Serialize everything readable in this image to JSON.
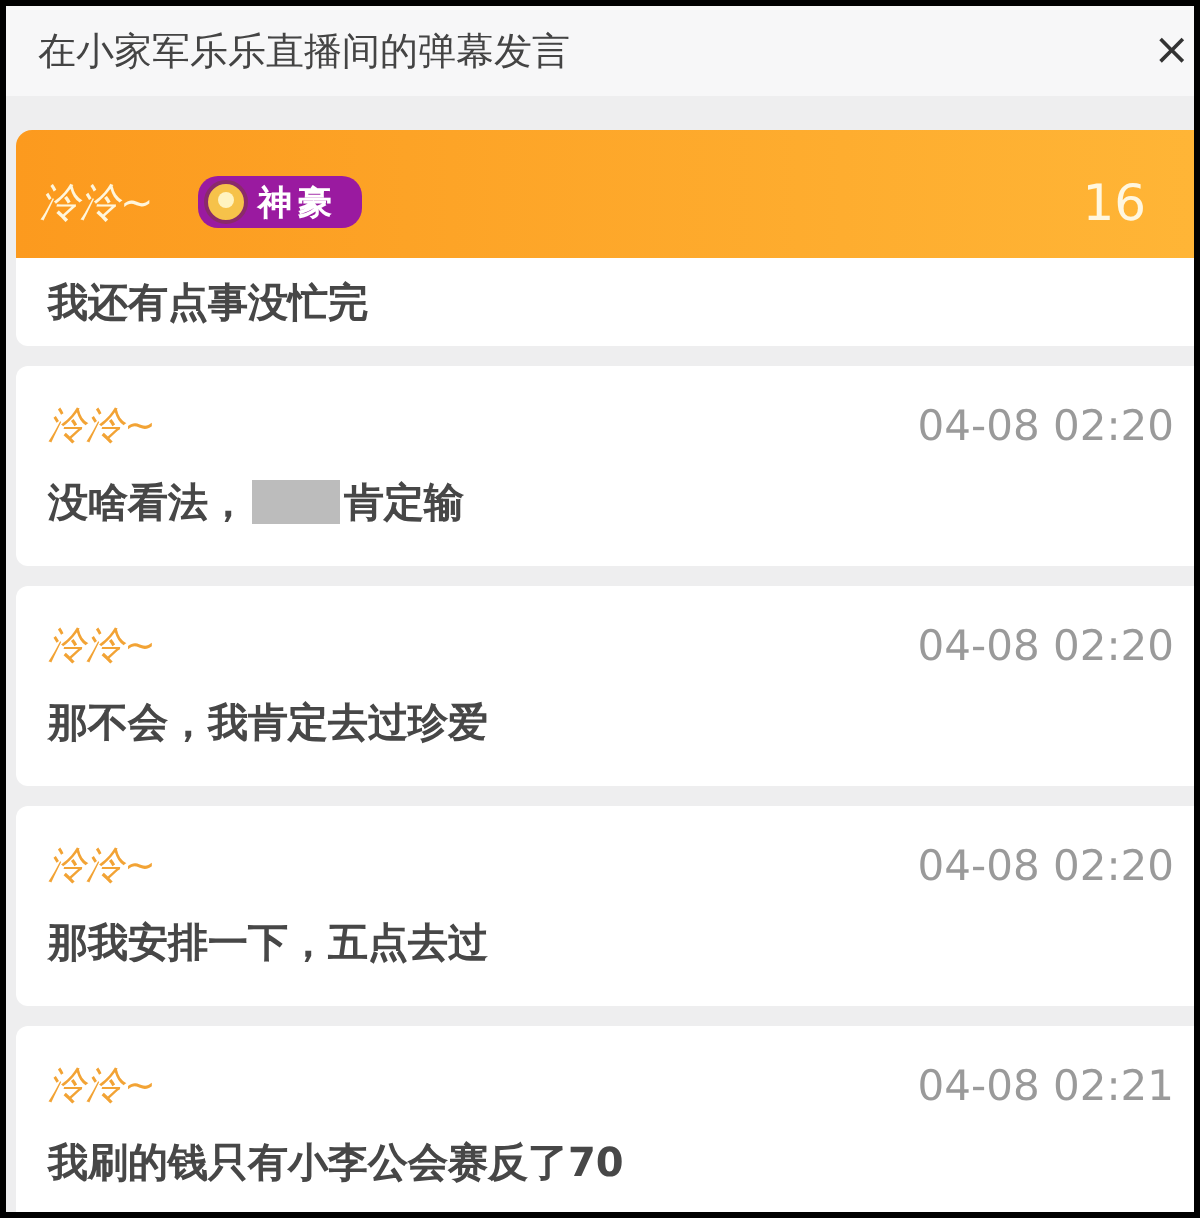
{
  "window": {
    "title": "在小家军乐乐直播间的弹幕发言",
    "close": "×"
  },
  "pinned": {
    "name": "泠泠~",
    "badge": "神豪",
    "count": "16"
  },
  "messages": [
    {
      "text": [
        "我还有点事没忙完"
      ]
    },
    {
      "name": "泠泠~",
      "time": "04-08 02:20",
      "text": [
        "没啥看法，",
        "肯定输"
      ]
    },
    {
      "name": "泠泠~",
      "time": "04-08 02:20",
      "text": [
        "那不会，我肯定去过珍爱"
      ]
    },
    {
      "name": "泠泠~",
      "time": "04-08 02:20",
      "text": [
        "那我安排一下，五点去过"
      ]
    },
    {
      "name": "泠泠~",
      "time": "04-08 02:21",
      "text": [
        "我刷的钱只有小李公会赛反了70"
      ]
    }
  ]
}
